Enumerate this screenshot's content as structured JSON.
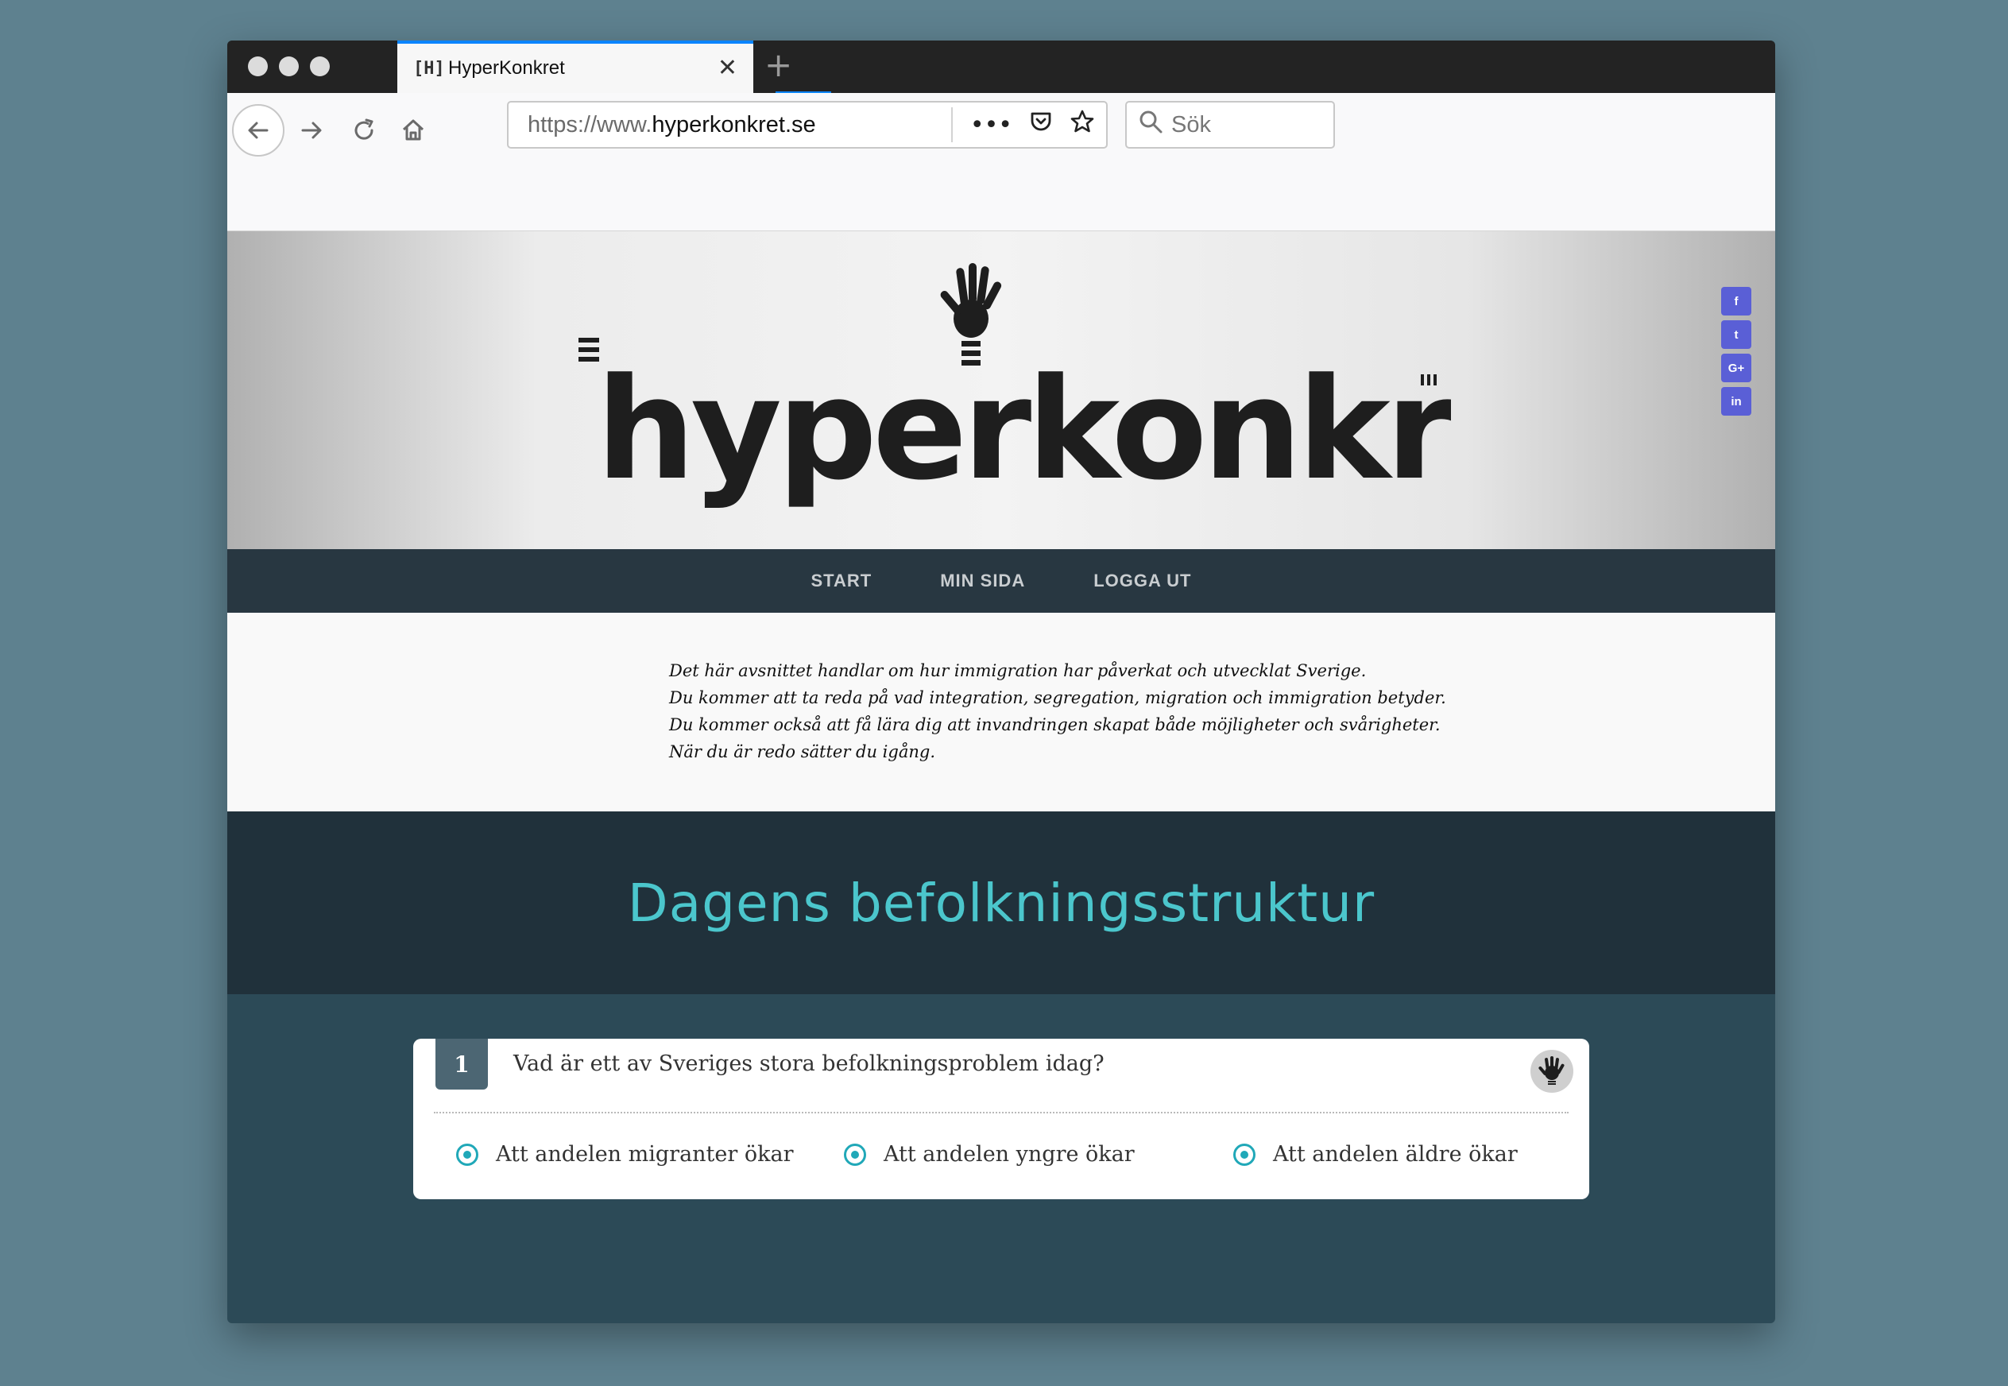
{
  "browser": {
    "tab_title": "HyperKonkret",
    "tab_favicon": "[H]",
    "url_prefix": "https://www.",
    "url_host": "hyperkonkret.se",
    "search_placeholder": "Sök"
  },
  "site": {
    "logo_text": "hyperkonkret",
    "social": [
      "f",
      "t",
      "G+",
      "in"
    ],
    "menu": [
      "START",
      "MIN SIDA",
      "LOGGA UT"
    ],
    "intro": [
      "Det här avsnittet handlar om hur immigration har påverkat och utvecklat Sverige.",
      "Du kommer att ta reda på vad integration, segregation, migration och immigration betyder.",
      "Du kommer också att få lära dig att invandringen skapat både möjligheter och svårigheter.",
      "När du är redo sätter du igång."
    ],
    "section_title": "Dagens befolkningsstruktur"
  },
  "question": {
    "number": "1",
    "text": "Vad är ett av Sveriges stora befolkningsproblem idag?",
    "options": [
      "Att andelen migranter ökar",
      "Att andelen yngre ökar",
      "Att andelen äldre ökar"
    ]
  },
  "colors": {
    "accent_teal": "#4bc6cc",
    "radio": "#20a8b8",
    "social_purple": "#5a5fd6",
    "nav_dark": "#283741"
  }
}
